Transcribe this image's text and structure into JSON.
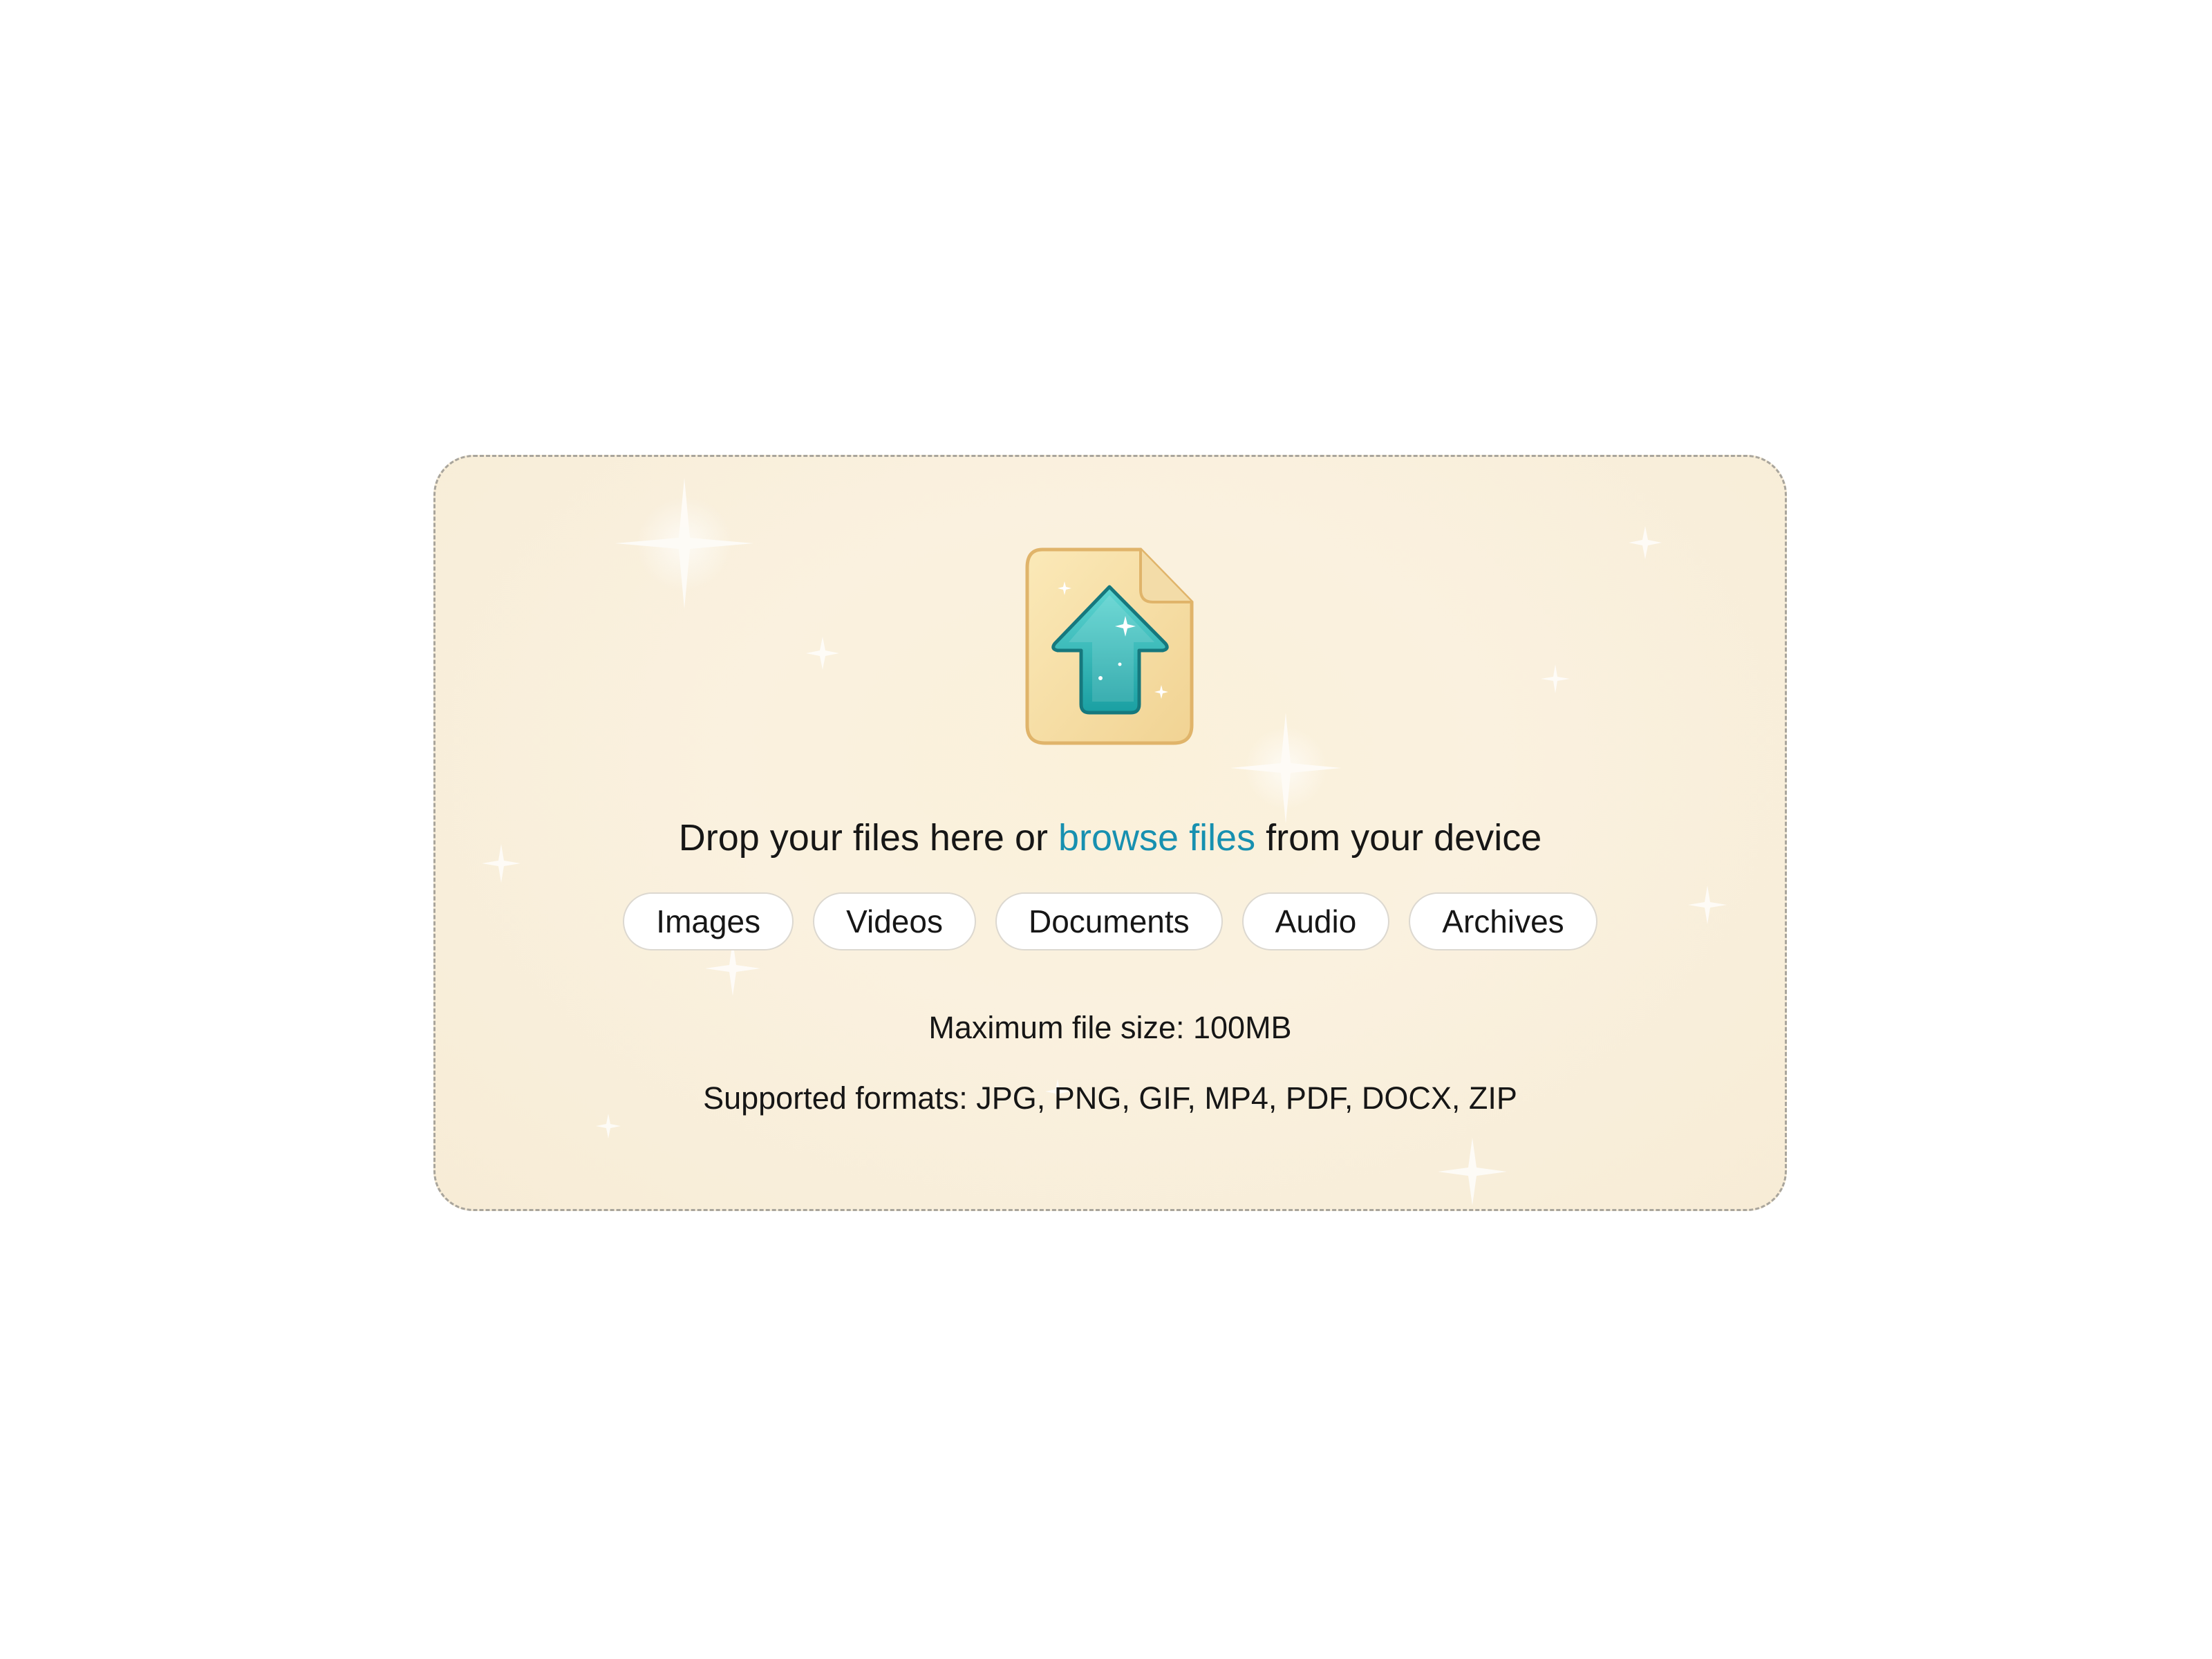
{
  "dropzone": {
    "icon": "file-upload-arrow-icon",
    "headline_prefix": "Drop your files here or ",
    "browse_link": "browse files",
    "headline_suffix": " from your device",
    "chips": [
      "Images",
      "Videos",
      "Documents",
      "Audio",
      "Archives"
    ],
    "max_size_text": "Maximum file size: 100MB",
    "formats_text": "Supported formats: JPG, PNG, GIF, MP4, PDF, DOCX, ZIP"
  },
  "colors": {
    "link": "#1790b0",
    "arrow": "#2bb5b5",
    "background": "#faf1df"
  }
}
